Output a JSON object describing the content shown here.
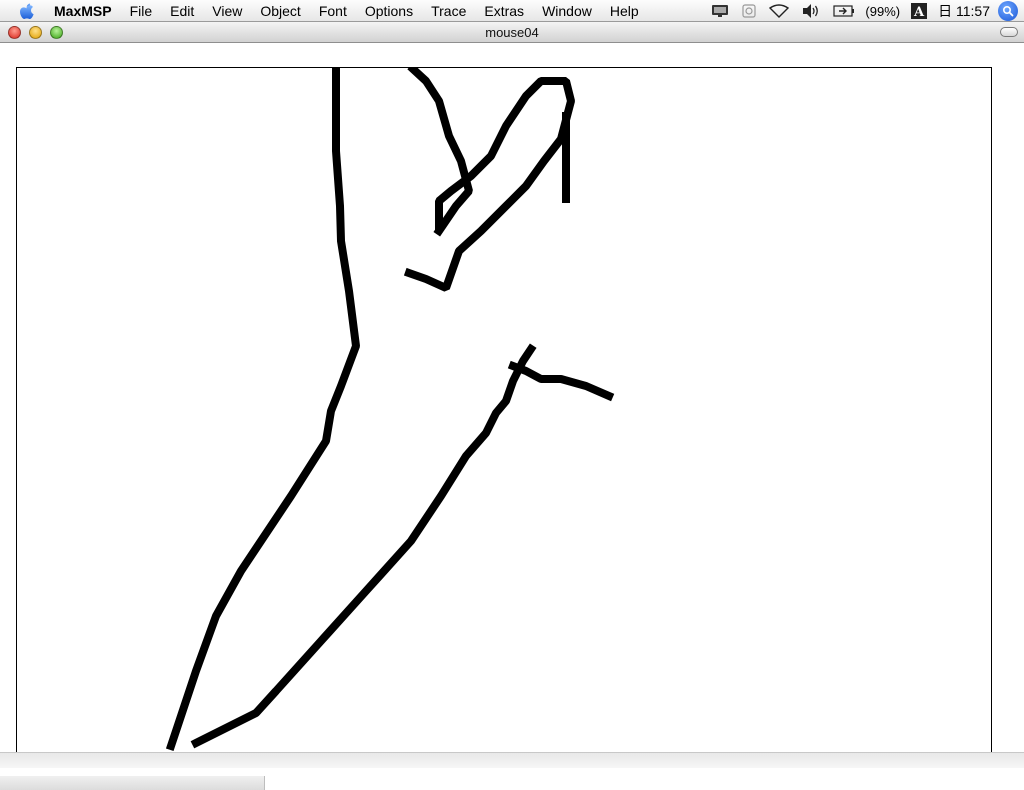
{
  "menubar": {
    "apple_icon": "apple-icon",
    "items": [
      {
        "label": "MaxMSP",
        "app": true
      },
      {
        "label": "File"
      },
      {
        "label": "Edit"
      },
      {
        "label": "View"
      },
      {
        "label": "Object"
      },
      {
        "label": "Font"
      },
      {
        "label": "Options"
      },
      {
        "label": "Trace"
      },
      {
        "label": "Extras"
      },
      {
        "label": "Window"
      },
      {
        "label": "Help"
      }
    ],
    "status": {
      "battery_percent": "(99%)",
      "clock": "日 11:57",
      "input_menu_letter": "A"
    }
  },
  "window": {
    "title": "mouse04",
    "drawing": {
      "stroke_color": "#000000",
      "background_color": "#ffffff",
      "strokes": 5
    }
  }
}
